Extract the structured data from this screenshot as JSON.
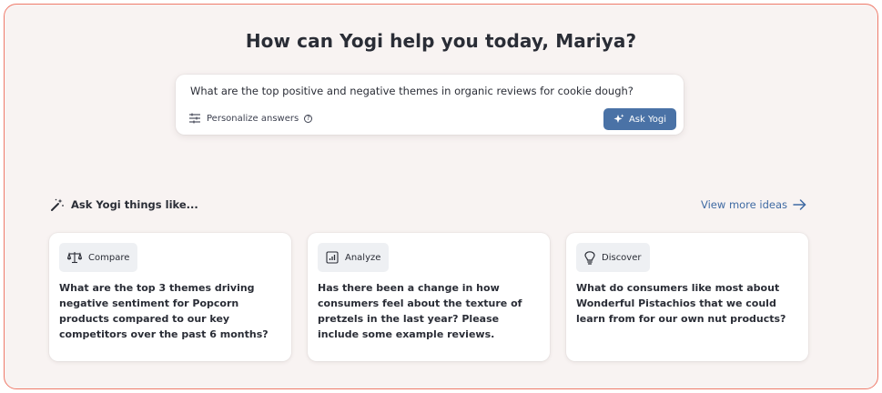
{
  "headline": "How can Yogi help you today, Mariya?",
  "ask": {
    "query": "What are the top positive and negative themes in organic reviews for cookie dough?",
    "personalize_label": "Personalize answers",
    "help_icon": "help-circle-icon",
    "button_label": "Ask Yogi",
    "button_color": "#4a72a6"
  },
  "ideas": {
    "heading": "Ask Yogi things like...",
    "view_more": "View more ideas",
    "cards": [
      {
        "tag": "Compare",
        "icon": "scales-icon",
        "text": "What are the top 3 themes driving negative sentiment for Popcorn products compared to our key competitors over the past 6 months?"
      },
      {
        "tag": "Analyze",
        "icon": "bar-chart-icon",
        "text": "Has there been a change in how consumers feel about the texture of pretzels in the last year? Please include some example reviews."
      },
      {
        "tag": "Discover",
        "icon": "lightbulb-icon",
        "text": "What do consumers like most about Wonderful Pistachios that we could learn from for our own nut products?"
      }
    ]
  },
  "colors": {
    "frame_border": "#ef7a6a",
    "background": "#f8f3f2",
    "link": "#3f6aa3"
  }
}
